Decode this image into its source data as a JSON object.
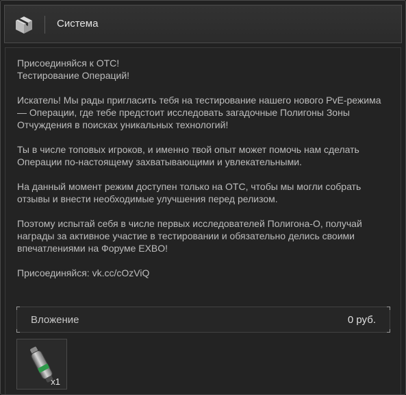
{
  "header": {
    "title": "Система",
    "icon": "box-icon"
  },
  "message": {
    "paragraphs": [
      "Присоединяйся к ОТС!\nТестирование Операций!",
      "Искатель! Мы рады пригласить тебя на тестирование нашего нового PvE-режима — Операции, где тебе предстоит исследовать загадочные Полигоны Зоны Отчуждения в поисках уникальных технологий!",
      "Ты в числе топовых игроков, и именно твой опыт может помочь нам сделать Операции по-настоящему захватывающими и увлекательными.",
      "На данный момент режим доступен только на ОТС, чтобы мы могли собрать отзывы и внести необходимые улучшения перед релизом.",
      "Поэтому испытай себя в числе первых исследователей Полигона-О, получай награды за активное участие в тестировании и обязательно делись своими впечатлениями на Форуме EXBO!",
      "Присоединяйся: vk.cc/cOzViQ"
    ]
  },
  "attachment": {
    "label": "Вложение",
    "value": "0  руб."
  },
  "item": {
    "count": "x1",
    "icon": "injector-icon",
    "accent_color": "#2e9a4a"
  }
}
